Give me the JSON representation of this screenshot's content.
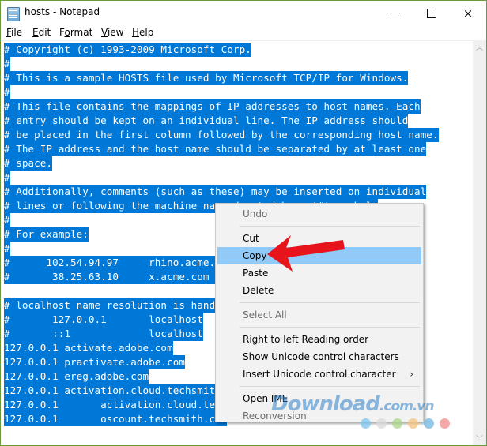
{
  "window": {
    "title": "hosts - Notepad",
    "controls": {
      "minimize": "minimize",
      "maximize": "maximize",
      "close": "×"
    }
  },
  "menubar": {
    "items": [
      {
        "label": "File",
        "mnemonic": "F",
        "rest": "ile"
      },
      {
        "label": "Edit",
        "mnemonic": "E",
        "rest": "dit"
      },
      {
        "label": "Format",
        "pre": "F",
        "mnemonic": "o",
        "rest": "rmat"
      },
      {
        "label": "View",
        "mnemonic": "V",
        "rest": "iew"
      },
      {
        "label": "Help",
        "mnemonic": "H",
        "rest": "elp"
      }
    ]
  },
  "editor": {
    "lines": [
      "# Copyright (c) 1993-2009 Microsoft Corp.",
      "#",
      "# This is a sample HOSTS file used by Microsoft TCP/IP for Windows.",
      "#",
      "# This file contains the mappings of IP addresses to host names. Each",
      "# entry should be kept on an individual line. The IP address should",
      "# be placed in the first column followed by the corresponding host name.",
      "# The IP address and the host name should be separated by at least one",
      "# space.",
      "#",
      "# Additionally, comments (such as these) may be inserted on individual",
      "# lines or following the machine name denoted by a '#' symbol.",
      "#",
      "# For example:",
      "#",
      "#      102.54.94.97     rhino.acme.com          # source server",
      "#       38.25.63.10     x.acme.com              # x client host",
      "",
      "# localhost name resolution is handled within DNS itself.",
      "#       127.0.0.1       localhost",
      "#       ::1             localhost",
      "127.0.0.1 activate.adobe.com",
      "127.0.0.1 practivate.adobe.com",
      "127.0.0.1 ereg.adobe.com",
      "127.0.0.1 activation.cloud.techsmith.com",
      "127.0.0.1       activation.cloud.techsmith.com",
      "127.0.0.1       oscount.techsmith.com"
    ],
    "selection": "all"
  },
  "context_menu": {
    "items": [
      {
        "label": "Undo",
        "enabled": false
      },
      {
        "separator": true
      },
      {
        "label": "Cut",
        "enabled": true
      },
      {
        "label": "Copy",
        "enabled": true,
        "highlighted": true
      },
      {
        "label": "Paste",
        "enabled": true
      },
      {
        "label": "Delete",
        "enabled": true
      },
      {
        "separator": true
      },
      {
        "label": "Select All",
        "enabled": false
      },
      {
        "separator": true
      },
      {
        "label": "Right to left Reading order",
        "enabled": true
      },
      {
        "label": "Show Unicode control characters",
        "enabled": true
      },
      {
        "label": "Insert Unicode control character",
        "enabled": true,
        "submenu": true
      },
      {
        "separator": true
      },
      {
        "label": "Open IME",
        "enabled": true
      },
      {
        "label": "Reconversion",
        "enabled": false
      }
    ],
    "submenu_arrow": "›"
  },
  "annotation": {
    "arrow_color": "#e8141c",
    "points_to": "Copy"
  },
  "watermark": {
    "text": "Download",
    "suffix": ".com.vn",
    "dot_colors": [
      "#7cc4ef",
      "#d9d9d9",
      "#a9d68a",
      "#f6c27e",
      "#6fb5e0",
      "#f28b8b"
    ]
  },
  "colors": {
    "selection": "#0078d7",
    "menu_highlight": "#91c9f7",
    "window_border": "#6b9a3a"
  }
}
